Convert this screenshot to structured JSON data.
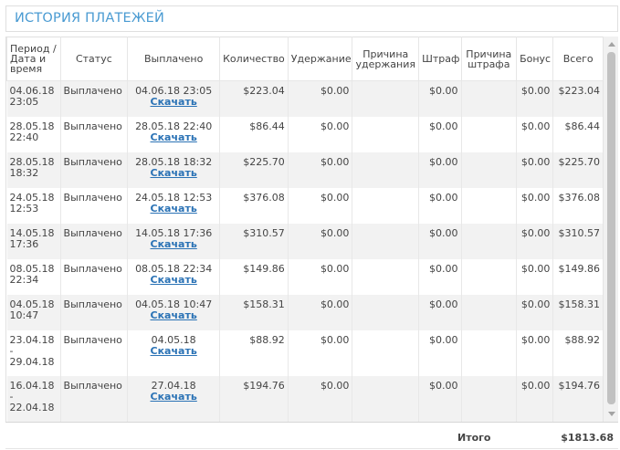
{
  "panel": {
    "title": "ИСТОРИЯ ПЛАТЕЖЕЙ"
  },
  "table": {
    "headers": {
      "period": "Период / Дата и время",
      "status": "Статус",
      "paid": "Выплачено",
      "amount": "Количество",
      "hold": "Удержание",
      "hold_reason": "Причина удержания",
      "fine": "Штраф",
      "fine_reason": "Причина штрафа",
      "bonus": "Бонус",
      "total": "Всего"
    },
    "rows": [
      {
        "period": "04.06.18 23:05",
        "status": "Выплачено",
        "paid": "04.06.18 23:05",
        "link": "Скачать",
        "amount": "$223.04",
        "hold": "$0.00",
        "hold_reason": "",
        "fine": "$0.00",
        "fine_reason": "",
        "bonus": "$0.00",
        "total": "$223.04"
      },
      {
        "period": "28.05.18 22:40",
        "status": "Выплачено",
        "paid": "28.05.18 22:40",
        "link": "Скачать",
        "amount": "$86.44",
        "hold": "$0.00",
        "hold_reason": "",
        "fine": "$0.00",
        "fine_reason": "",
        "bonus": "$0.00",
        "total": "$86.44"
      },
      {
        "period": "28.05.18 18:32",
        "status": "Выплачено",
        "paid": "28.05.18 18:32",
        "link": "Скачать",
        "amount": "$225.70",
        "hold": "$0.00",
        "hold_reason": "",
        "fine": "$0.00",
        "fine_reason": "",
        "bonus": "$0.00",
        "total": "$225.70"
      },
      {
        "period": "24.05.18 12:53",
        "status": "Выплачено",
        "paid": "24.05.18 12:53",
        "link": "Скачать",
        "amount": "$376.08",
        "hold": "$0.00",
        "hold_reason": "",
        "fine": "$0.00",
        "fine_reason": "",
        "bonus": "$0.00",
        "total": "$376.08"
      },
      {
        "period": "14.05.18 17:36",
        "status": "Выплачено",
        "paid": "14.05.18 17:36",
        "link": "Скачать",
        "amount": "$310.57",
        "hold": "$0.00",
        "hold_reason": "",
        "fine": "$0.00",
        "fine_reason": "",
        "bonus": "$0.00",
        "total": "$310.57"
      },
      {
        "period": "08.05.18 22:34",
        "status": "Выплачено",
        "paid": "08.05.18 22:34",
        "link": "Скачать",
        "amount": "$149.86",
        "hold": "$0.00",
        "hold_reason": "",
        "fine": "$0.00",
        "fine_reason": "",
        "bonus": "$0.00",
        "total": "$149.86"
      },
      {
        "period": "04.05.18 10:47",
        "status": "Выплачено",
        "paid": "04.05.18 10:47",
        "link": "Скачать",
        "amount": "$158.31",
        "hold": "$0.00",
        "hold_reason": "",
        "fine": "$0.00",
        "fine_reason": "",
        "bonus": "$0.00",
        "total": "$158.31"
      },
      {
        "period": "23.04.18 - 29.04.18",
        "status": "Выплачено",
        "paid": "04.05.18",
        "link": "Скачать",
        "amount": "$88.92",
        "hold": "$0.00",
        "hold_reason": "",
        "fine": "$0.00",
        "fine_reason": "",
        "bonus": "$0.00",
        "total": "$88.92"
      },
      {
        "period": "16.04.18 - 22.04.18",
        "status": "Выплачено",
        "paid": "27.04.18",
        "link": "Скачать",
        "amount": "$194.76",
        "hold": "$0.00",
        "hold_reason": "",
        "fine": "$0.00",
        "fine_reason": "",
        "bonus": "$0.00",
        "total": "$194.76"
      }
    ]
  },
  "footer": {
    "label": "Итого",
    "total": "$1813.68"
  },
  "colors": {
    "title": "#4a9bd2",
    "link": "#2a72b5",
    "row_alt": "#f2f2f2"
  }
}
